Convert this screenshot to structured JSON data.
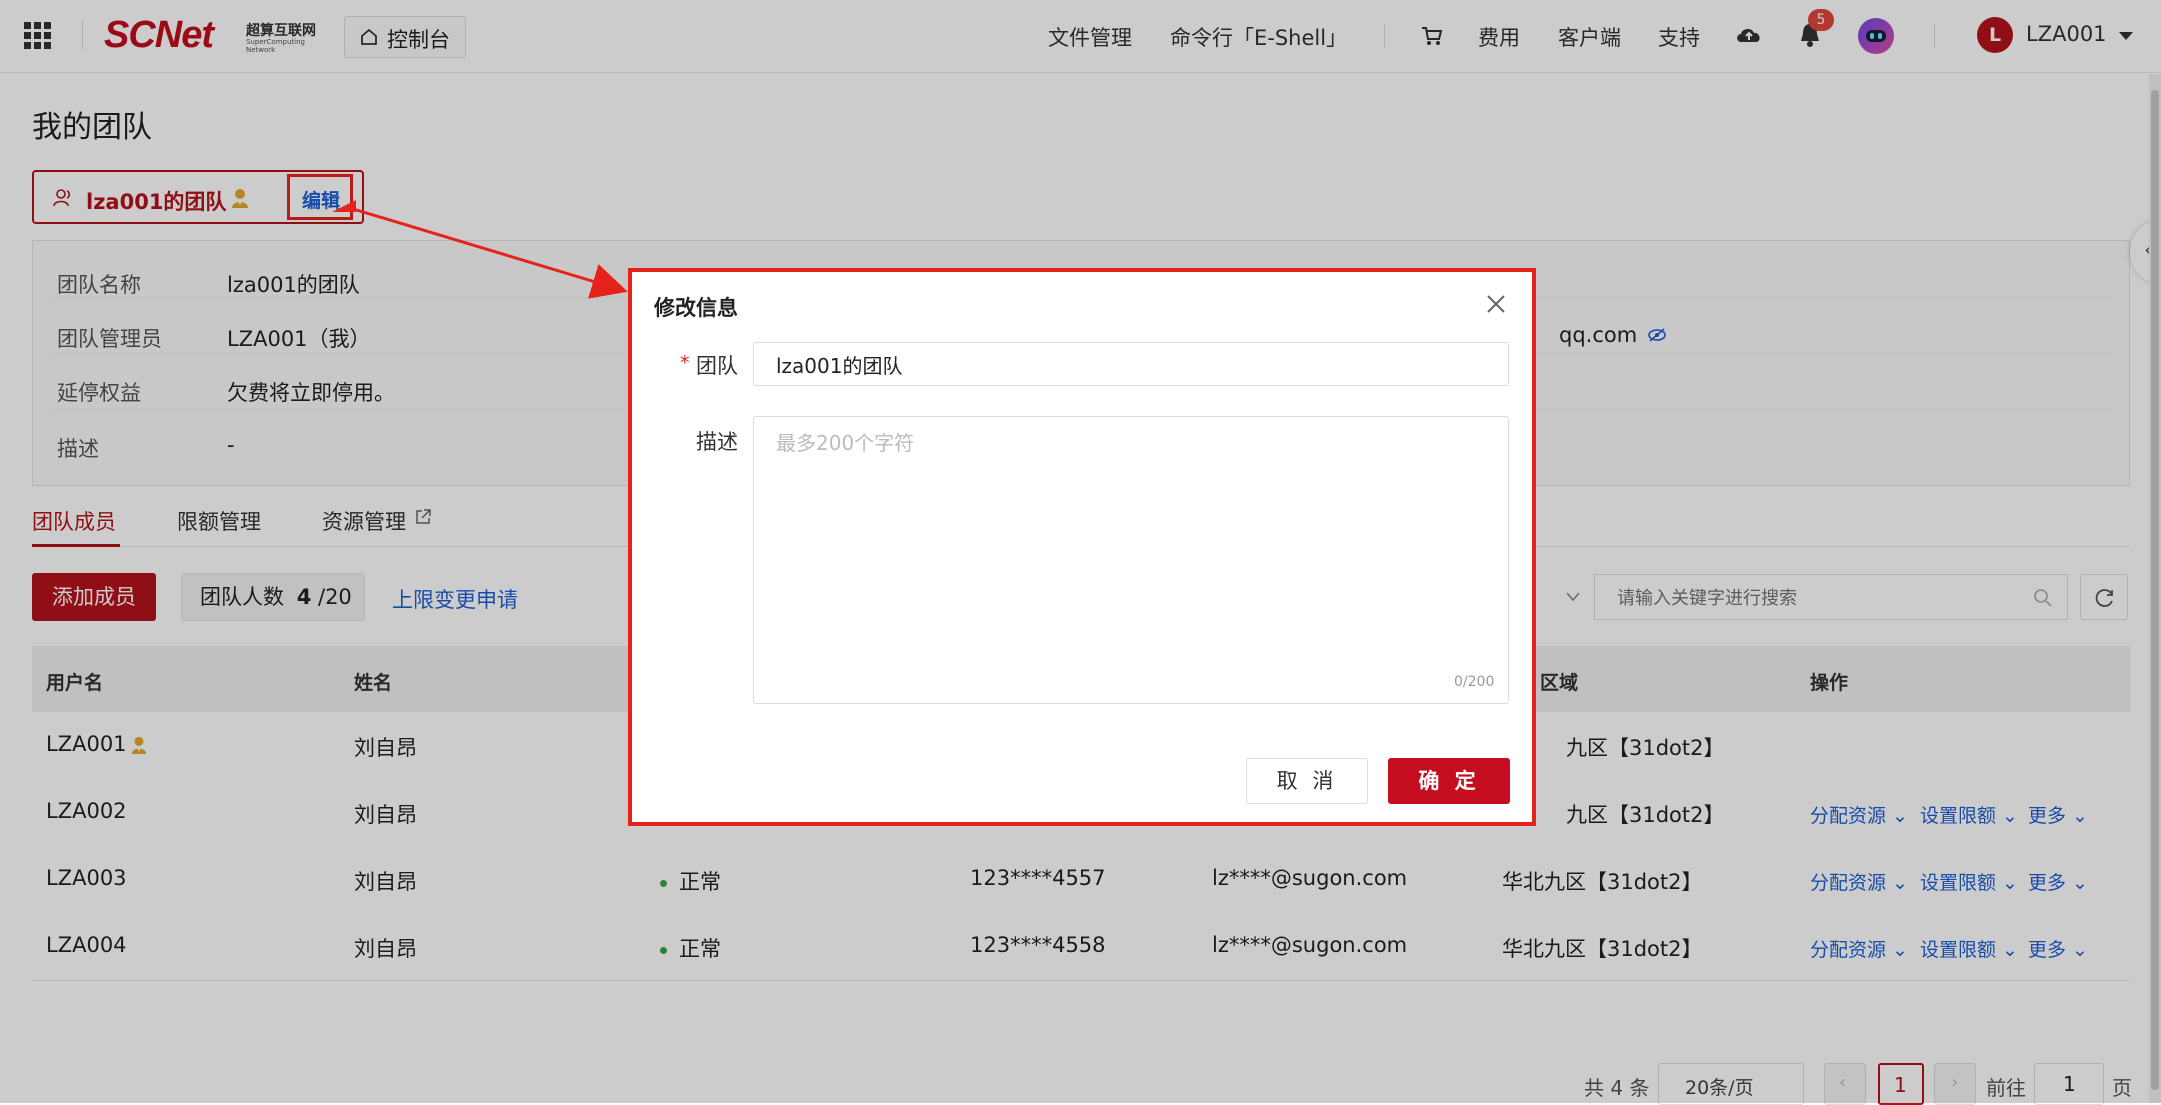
{
  "header": {
    "logo_text": "SCNet",
    "logo_cn": "超算互联网",
    "logo_en": "SuperComputing Network",
    "console_label": "控制台",
    "nav": [
      "文件管理",
      "命令行「E-Shell」",
      "费用",
      "客户端",
      "支持"
    ],
    "notification_count": "5",
    "avatar_letter": "L",
    "username": "LZA001"
  },
  "page": {
    "title": "我的团队",
    "team_chip_name": "lza001的团队",
    "edit_label": "编辑"
  },
  "info": {
    "rows": [
      {
        "label": "团队名称",
        "value": "lza001的团队"
      },
      {
        "label": "团队管理员",
        "value": "LZA001（我）"
      },
      {
        "label": "延停权益",
        "value": "欠费将立即停用。"
      },
      {
        "label": "描述",
        "value": "-"
      }
    ],
    "email_partial": "qq.com"
  },
  "tabs": [
    "团队成员",
    "限额管理",
    "资源管理"
  ],
  "toolbar": {
    "add_member": "添加成员",
    "count_prefix": "团队人数",
    "count_value": "4",
    "count_suffix": "/20",
    "limit_change": "上限变更申请",
    "search_placeholder": "请输入关键字进行搜索"
  },
  "table": {
    "columns": [
      "用户名",
      "姓名",
      "区域",
      "操作"
    ],
    "rows": [
      {
        "username": "LZA001",
        "name": "刘自昂",
        "status": "",
        "phone": "",
        "email": "",
        "region": "九区【31dot2】",
        "admin": true
      },
      {
        "username": "LZA002",
        "name": "刘自昂",
        "status": "",
        "phone": "",
        "email": "",
        "region": "九区【31dot2】",
        "admin": false
      },
      {
        "username": "LZA003",
        "name": "刘自昂",
        "status": "正常",
        "phone": "123****4557",
        "email": "lz****@sugon.com",
        "region": "华北九区【31dot2】",
        "admin": false
      },
      {
        "username": "LZA004",
        "name": "刘自昂",
        "status": "正常",
        "phone": "123****4558",
        "email": "lz****@sugon.com",
        "region": "华北九区【31dot2】",
        "admin": false
      }
    ],
    "ops": [
      "分配资源",
      "设置限额",
      "更多"
    ]
  },
  "pager": {
    "total": "共 4 条",
    "page_size": "20条/页",
    "current": "1",
    "goto_prefix": "前往",
    "goto_value": "1",
    "goto_suffix": "页"
  },
  "modal": {
    "title": "修改信息",
    "team_label": "团队",
    "team_value": "lza001的团队",
    "desc_label": "描述",
    "desc_placeholder": "最多200个字符",
    "char_count": "0/200",
    "cancel": "取 消",
    "ok": "确 定"
  },
  "colors": {
    "brand_red": "#b5121b",
    "annotation_red": "#e5231b",
    "link_blue": "#1f5fd6",
    "status_green": "#3aa346"
  }
}
